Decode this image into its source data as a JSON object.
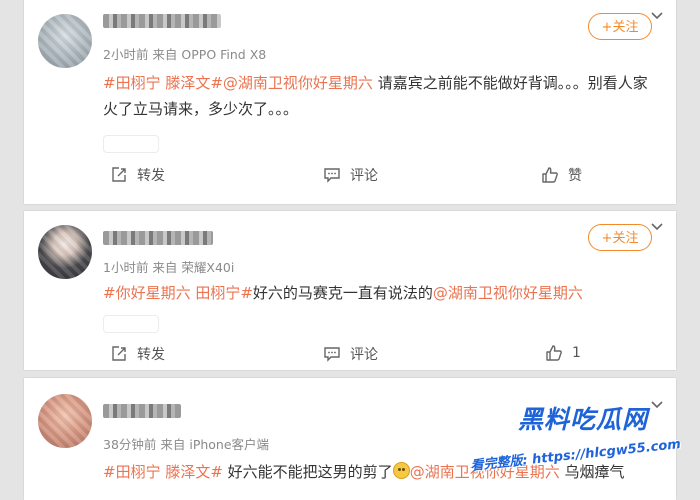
{
  "posts": [
    {
      "meta": "2小时前 来自 OPPO Find X8",
      "follow_label": "+关注",
      "segments": [
        {
          "text": "#田栩宁 滕泽文#",
          "tag": true
        },
        {
          "text": "@湖南卫视你好星期六",
          "tag": true
        },
        {
          "text": " 请嘉宾之前能不能做好背调。。。别看人家火了立马请来，多少次了。。。",
          "tag": false
        }
      ],
      "actions": {
        "repost": "转发",
        "comment": "评论",
        "like": "赞"
      }
    },
    {
      "meta": "1小时前 来自 荣耀X40i",
      "follow_label": "+关注",
      "segments": [
        {
          "text": "#你好星期六 田栩宁#",
          "tag": true
        },
        {
          "text": "好六的马赛克一直有说法的",
          "tag": false
        },
        {
          "text": "@湖南卫视你好星期六",
          "tag": true
        }
      ],
      "actions": {
        "repost": "转发",
        "comment": "评论",
        "like": "1"
      }
    },
    {
      "meta": "38分钟前 来自 iPhone客户端",
      "segments": [
        {
          "text": "#田栩宁 滕泽文#",
          "tag": true
        },
        {
          "text": " 好六能不能把这男的剪了",
          "tag": false
        },
        {
          "emoji": "smile-emoji"
        },
        {
          "text": "@湖南",
          "tag": true
        },
        {
          "text": "卫视你好星期六",
          "tag": true
        },
        {
          "text": " 乌烟瘴气",
          "tag": false
        }
      ]
    }
  ],
  "watermark": {
    "title": "黑料吃瓜网",
    "url": "看完整版: https://hlcgw55.com"
  },
  "colors": {
    "tag": "#eb7350",
    "follow": "#f28a2c",
    "background": "#e4e4e4",
    "watermark": "#1e63d8"
  },
  "icons": {
    "menu": "chevron-down-icon",
    "repost": "repost-icon",
    "comment": "comment-icon",
    "like": "thumbs-up-icon"
  }
}
